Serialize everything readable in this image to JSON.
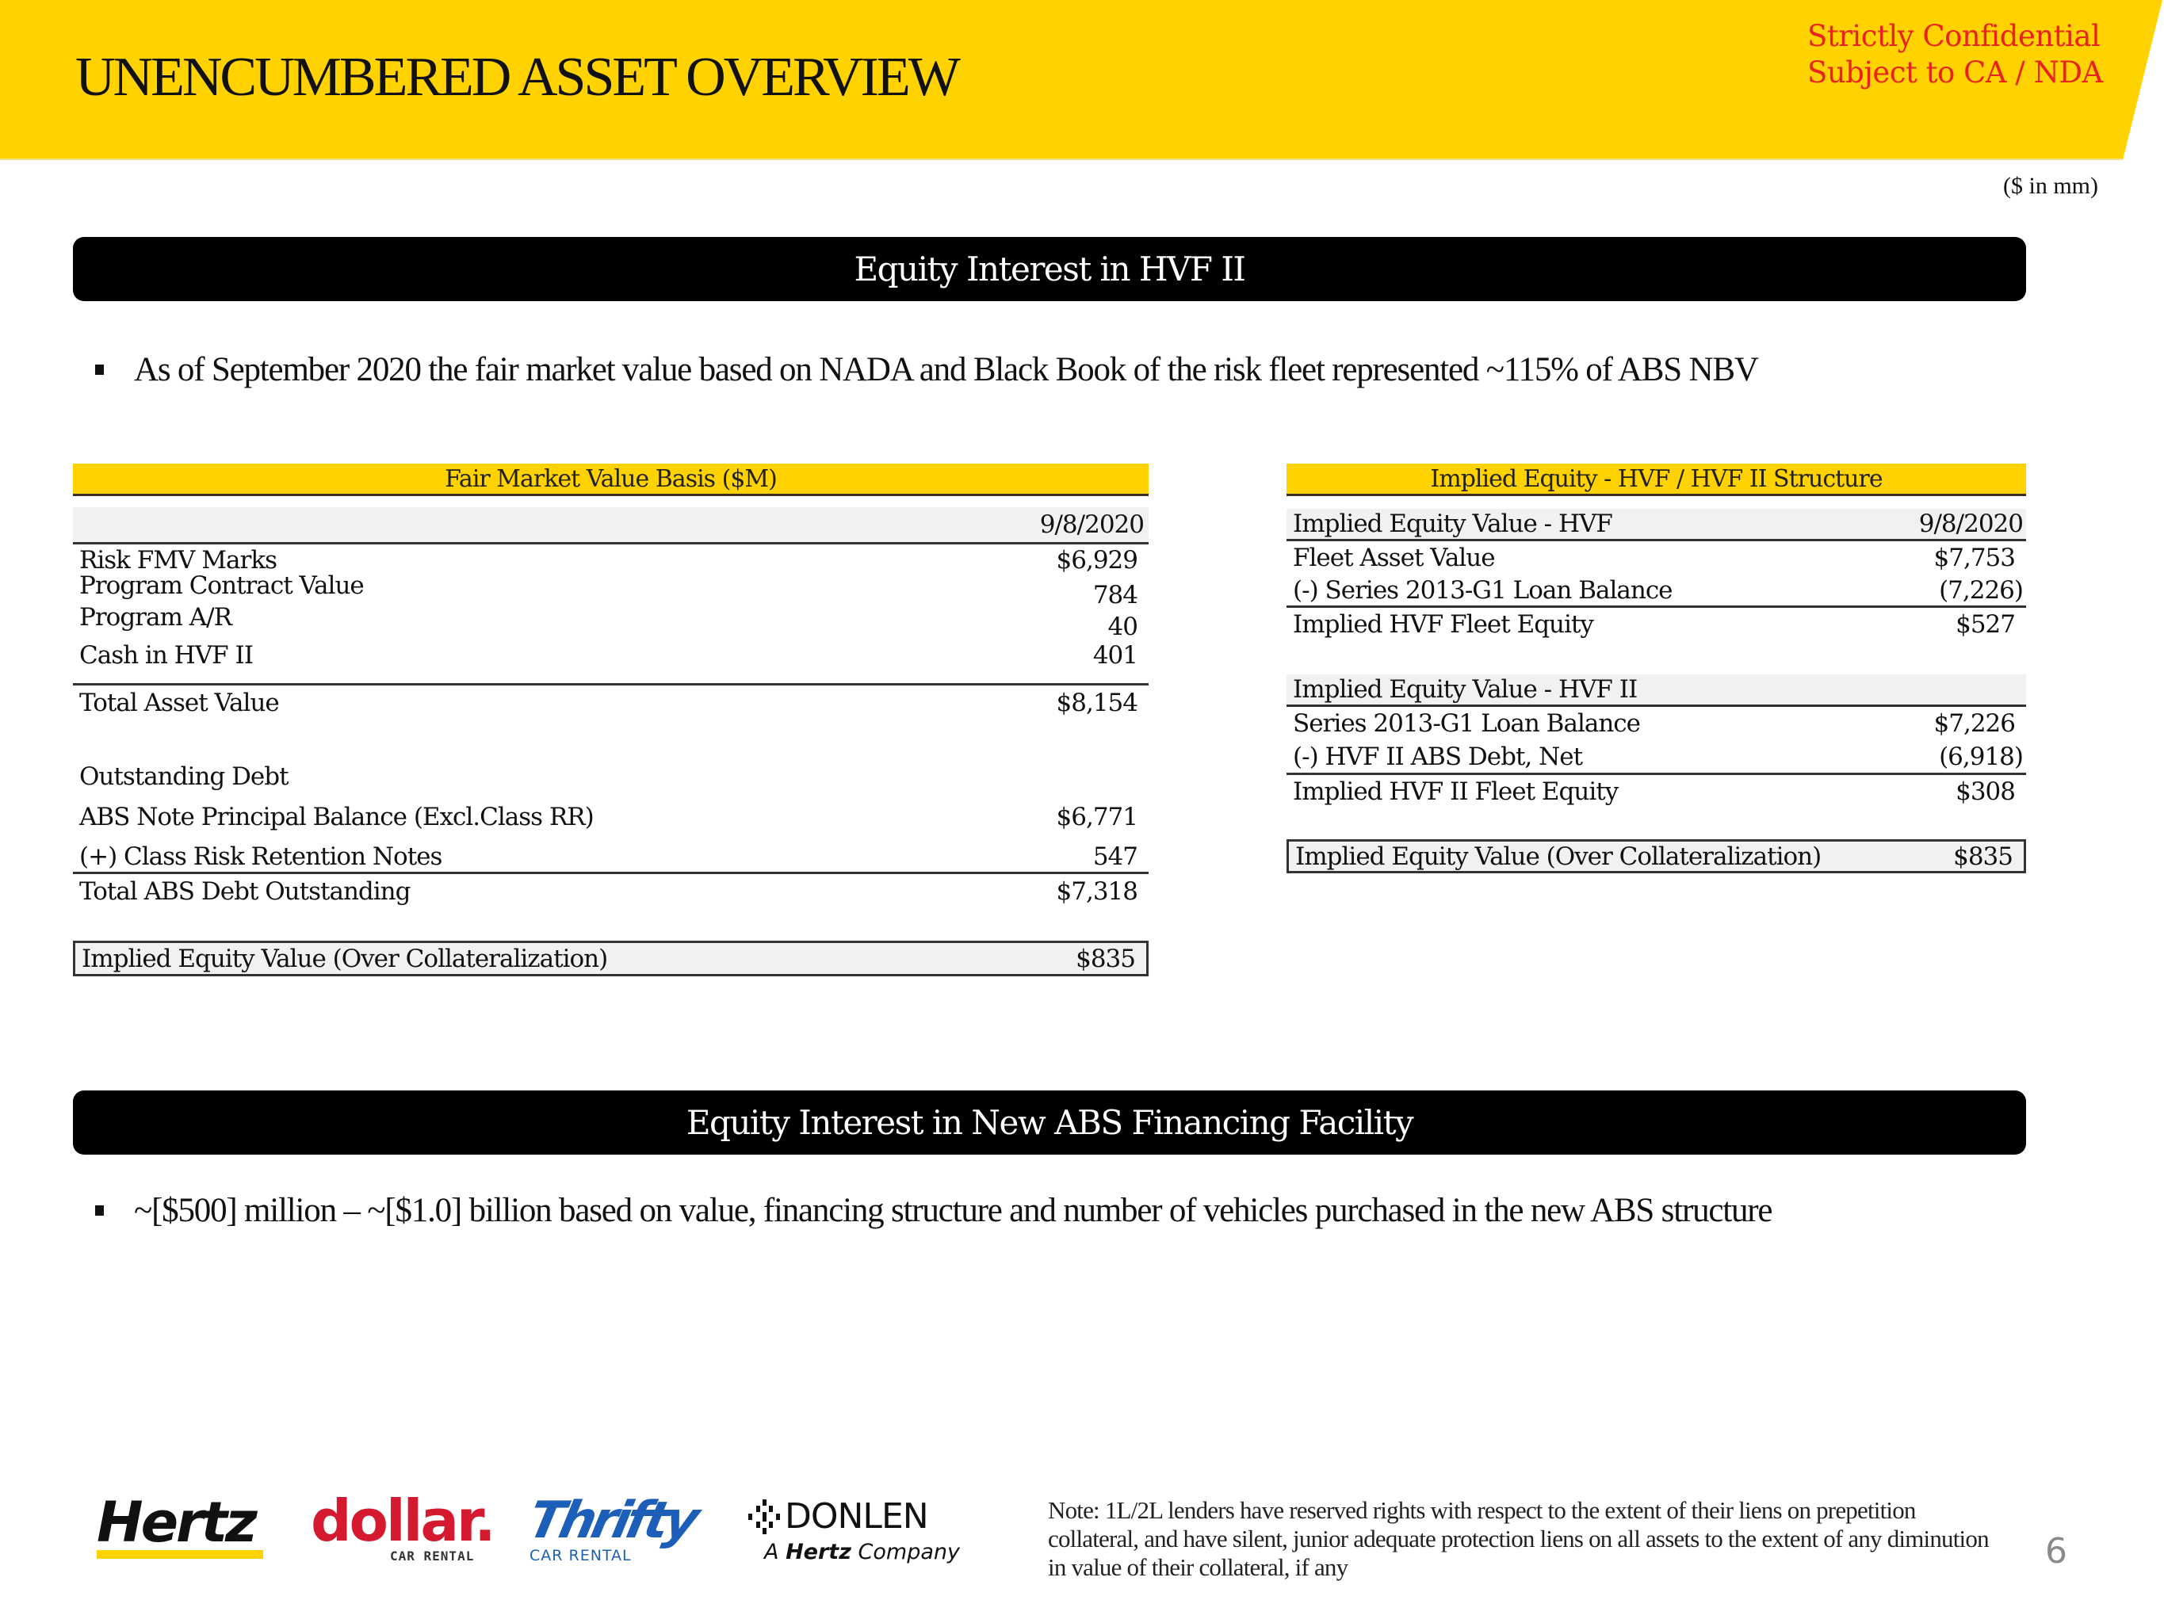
{
  "header": {
    "title": "UNENCUMBERED ASSET OVERVIEW",
    "confidential_line1": "Strictly Confidential",
    "confidential_line2": "Subject to CA / NDA",
    "units": "($ in mm)",
    "band_color": "#ffd200",
    "confidential_color": "#e8231e"
  },
  "section1": {
    "title": "Equity Interest in HVF II",
    "bullet": "As of September 2020 the fair market value based on NADA and Black Book of the risk fleet represented ~115% of ABS NBV"
  },
  "left_table": {
    "title": "Fair Market Value Basis ($M)",
    "date_header": "9/8/2020",
    "asset_rows": [
      {
        "label": "Risk FMV Marks",
        "value": "$6,929"
      },
      {
        "label": "Program Contract Value",
        "value": "784"
      },
      {
        "label": "Program A/R",
        "value": "40"
      },
      {
        "label": "Cash in HVF II",
        "value": "401"
      }
    ],
    "total_asset": {
      "label": "Total Asset Value",
      "value": "$8,154"
    },
    "debt_heading": "Outstanding Debt",
    "debt_rows": [
      {
        "label": "ABS Note Principal Balance (Excl.Class RR)",
        "value": "$6,771"
      },
      {
        "label": "(+) Class Risk Retention Notes",
        "value": "547"
      }
    ],
    "total_debt": {
      "label": "Total ABS Debt Outstanding",
      "value": "$7,318"
    },
    "implied": {
      "label": "Implied Equity Value (Over Collateralization)",
      "value": "$835"
    }
  },
  "right_table": {
    "title": "Implied Equity - HVF / HVF II Structure",
    "hvf_header": {
      "label": "Implied Equity Value - HVF",
      "value": "9/8/2020"
    },
    "hvf_rows": [
      {
        "label": "Fleet Asset Value",
        "value": "$7,753"
      },
      {
        "label": "(-) Series 2013-G1 Loan Balance",
        "value": "(7,226)"
      }
    ],
    "hvf_total": {
      "label": "Implied HVF Fleet Equity",
      "value": "$527"
    },
    "hvf2_header": {
      "label": "Implied Equity Value - HVF II",
      "value": ""
    },
    "hvf2_rows": [
      {
        "label": "Series 2013-G1 Loan Balance",
        "value": "$7,226"
      },
      {
        "label": "(-) HVF II ABS Debt, Net",
        "value": "(6,918)"
      }
    ],
    "hvf2_total": {
      "label": "Implied HVF II Fleet Equity",
      "value": "$308"
    },
    "implied": {
      "label": "Implied Equity Value (Over Collateralization)",
      "value": "$835"
    }
  },
  "section2": {
    "title": "Equity Interest in New ABS Financing Facility",
    "bullet": "~[$500] million – ~[$1.0] billion based on value, financing structure and number of vehicles purchased in the new ABS structure"
  },
  "logos": {
    "hertz": "Hertz",
    "dollar": "dollar.",
    "dollar_sub": "CAR RENTAL",
    "thrifty": "Thrifty",
    "thrifty_sub": "CAR RENTAL",
    "donlen": "DONLEN",
    "donlen_sub_a": "A",
    "donlen_sub_brand": "Hertz",
    "donlen_sub_b": "Company",
    "hertz_color": "#ffd200",
    "dollar_color": "#d5192e",
    "thrifty_color": "#1d5fb8"
  },
  "footer": {
    "note": "Note: 1L/2L lenders have reserved rights with respect to the extent of their liens on prepetition collateral, and have silent, junior adequate protection liens on all assets to the extent of any diminution in value of their collateral, if any",
    "page_number": "6"
  }
}
